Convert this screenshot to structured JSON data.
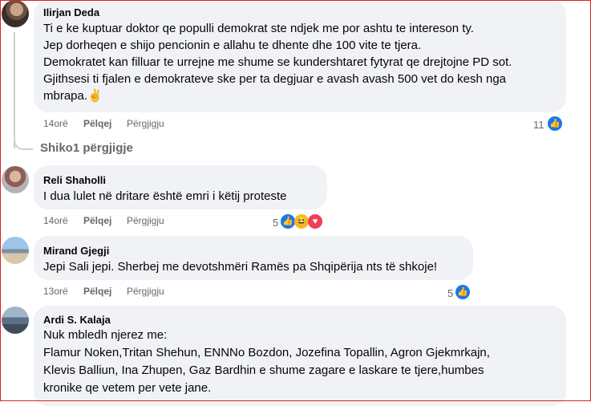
{
  "comments": [
    {
      "author": "Ilirjan Deda",
      "lines": [
        "Ti e ke kuptuar doktor qe populli demokrat ste ndjek me por ashtu te intereson ty.",
        "Jep dorheqen e shijo pencionin e allahu te dhente dhe 100 vite te tjera.",
        "Demokratet kan filluar te urrejne me shume se kundershtaret fytyrat qe drejtojne PD sot.",
        "Gjithsesi ti fjalen e demokrateve ske per ta degjuar e avash avash 500 vet do kesh nga",
        "mbrapa.✌"
      ],
      "time": "14orë",
      "reply": "Pëlqej",
      "reply2": "Përgjigju",
      "reactions": "11"
    },
    {
      "author": "Reli Shaholli",
      "lines": [
        "I dua lulet në dritare është emri i këtij proteste"
      ],
      "time": "14orë",
      "reply": "Pëlqej",
      "reply2": "Përgjigju",
      "reactions": "5"
    },
    {
      "author": "Mirand Gjegji",
      "lines": [
        "Jepi Sali jepi. Sherbej me devotshmëri Ramës pa Shqipërija nts të shkoje!"
      ],
      "time": "13orë",
      "reply": "Pëlqej",
      "reply2": "Përgjigju",
      "reactions": "5"
    },
    {
      "author": "Ardi S. Kalaja",
      "lines": [
        "Nuk mbledh njerez me:",
        "Flamur Noken,Tritan Shehun, ENNNo Bozdon, Jozefina Topallin, Agron Gjekmrkajn,",
        "Klevis Balliun, Ina Zhupen, Gaz Bardhin e shume zagare e laskare te tjere,humbes",
        "kronike qe vetem per vete jane."
      ]
    }
  ],
  "view_replies": "Shiko1 përgjigje",
  "icons": {
    "like": "thumbs-up-icon",
    "haha": "laughing-face-icon",
    "love": "heart-icon"
  },
  "colors": {
    "bubble": "#f0f2f5",
    "meta_text": "#65676b",
    "like_blue": "#1877f2",
    "frame_red": "#e02020"
  }
}
